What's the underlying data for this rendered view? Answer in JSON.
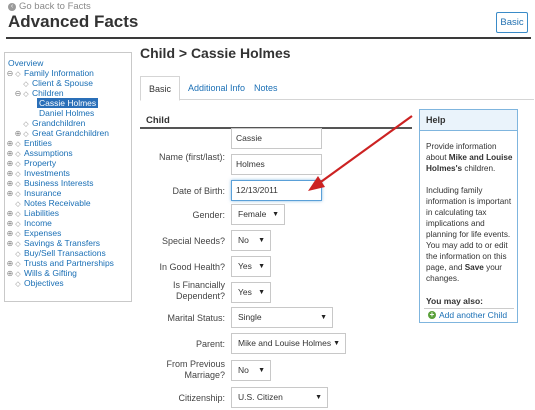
{
  "header": {
    "back_link": "Go back to Facts",
    "title": "Advanced Facts",
    "basic_button": "Basic"
  },
  "sidebar": {
    "items": [
      {
        "label": "Overview",
        "indent": 0,
        "icon": "none"
      },
      {
        "label": "Family Information",
        "indent": 0,
        "icon": "collapse"
      },
      {
        "label": "Client & Spouse",
        "indent": 1,
        "icon": "leaf"
      },
      {
        "label": "Children",
        "indent": 1,
        "icon": "collapse"
      },
      {
        "label": "Cassie Holmes",
        "indent": 2,
        "icon": "none",
        "selected": true
      },
      {
        "label": "Daniel Holmes",
        "indent": 2,
        "icon": "none"
      },
      {
        "label": "Grandchildren",
        "indent": 1,
        "icon": "leaf"
      },
      {
        "label": "Great Grandchildren",
        "indent": 1,
        "icon": "expand"
      },
      {
        "label": "Entities",
        "indent": 0,
        "icon": "expand"
      },
      {
        "label": "Assumptions",
        "indent": 0,
        "icon": "expand"
      },
      {
        "label": "Property",
        "indent": 0,
        "icon": "expand"
      },
      {
        "label": "Investments",
        "indent": 0,
        "icon": "expand"
      },
      {
        "label": "Business Interests",
        "indent": 0,
        "icon": "expand"
      },
      {
        "label": "Insurance",
        "indent": 0,
        "icon": "expand"
      },
      {
        "label": "Notes Receivable",
        "indent": 0,
        "icon": "leaf"
      },
      {
        "label": "Liabilities",
        "indent": 0,
        "icon": "expand"
      },
      {
        "label": "Income",
        "indent": 0,
        "icon": "expand"
      },
      {
        "label": "Expenses",
        "indent": 0,
        "icon": "expand"
      },
      {
        "label": "Savings & Transfers",
        "indent": 0,
        "icon": "expand"
      },
      {
        "label": "Buy/Sell Transactions",
        "indent": 0,
        "icon": "leaf"
      },
      {
        "label": "Trusts and Partnerships",
        "indent": 0,
        "icon": "expand"
      },
      {
        "label": "Wills & Gifting",
        "indent": 0,
        "icon": "expand"
      },
      {
        "label": "Objectives",
        "indent": 0,
        "icon": "leaf"
      }
    ]
  },
  "main": {
    "heading": "Child > Cassie Holmes",
    "tabs": [
      {
        "label": "Basic",
        "active": true
      },
      {
        "label": "Additional Info",
        "active": false
      },
      {
        "label": "Notes",
        "active": false
      }
    ],
    "section_title": "Child",
    "form": {
      "name_label": "Name (first/last):",
      "first_name": "Cassie",
      "last_name": "Holmes",
      "dob_label": "Date of Birth:",
      "dob_value": "12/13/2011",
      "gender_label": "Gender:",
      "gender_value": "Female",
      "special_needs_label": "Special Needs?",
      "special_needs_value": "No",
      "good_health_label": "In Good Health?",
      "good_health_value": "Yes",
      "financially_dependent_label": "Is Financially Dependent?",
      "financially_dependent_value": "Yes",
      "marital_status_label": "Marital Status:",
      "marital_status_value": "Single",
      "parent_label": "Parent:",
      "parent_value": "Mike and Louise Holmes",
      "previous_marriage_label": "From Previous Marriage?",
      "previous_marriage_value": "No",
      "citizenship_label": "Citizenship:",
      "citizenship_value": "U.S. Citizen"
    }
  },
  "help": {
    "title": "Help",
    "p1_prefix": "Provide information about ",
    "p1_bold": "Mike and Louise Holmes's",
    "p1_suffix": " children.",
    "p2": "Including family information is important in calculating tax implications and planning for life events.",
    "p3_prefix": "You may add to or edit the information on this page, and ",
    "p3_bold": "Save",
    "p3_suffix": " your changes.",
    "you_may_also": "You may also:",
    "add_link": "Add another Child"
  },
  "colors": {
    "link": "#1a6fb5",
    "selected_bg": "#2a6fb8",
    "arrow": "#cc2222",
    "help_border": "#7fb5de"
  }
}
